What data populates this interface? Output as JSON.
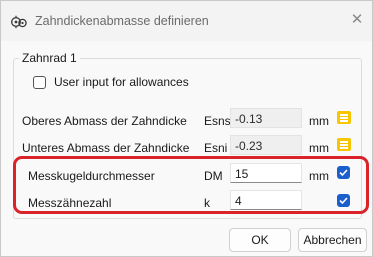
{
  "window": {
    "title": "Zahndickenabmasse definieren",
    "app_icon": "gear-icon",
    "close_glyph": "✕"
  },
  "group": {
    "label": "Zahnrad 1"
  },
  "allowance_checkbox": {
    "label": "User input for allowances",
    "checked": false
  },
  "rows": [
    {
      "label": "Oberes Abmass der Zahndicke",
      "symbol": "Esns",
      "value": "-0.13",
      "unit": "mm",
      "control": "menu-icon",
      "editable": false
    },
    {
      "label": "Unteres Abmass der Zahndicke",
      "symbol": "Esni",
      "value": "-0.23",
      "unit": "mm",
      "control": "menu-icon",
      "editable": false
    },
    {
      "label": "Messkugeldurchmesser",
      "symbol": "DM",
      "value": "15",
      "unit": "mm",
      "control": "checkbox",
      "checked": true,
      "editable": true
    },
    {
      "label": "Messzähnezahl",
      "symbol": "k",
      "value": "4",
      "unit": "",
      "control": "checkbox",
      "checked": true,
      "editable": true
    }
  ],
  "buttons": {
    "ok": "OK",
    "cancel": "Abbrechen"
  },
  "colors": {
    "highlight": "#d9222a",
    "checkbox_accent": "#1b5fcc",
    "menu_button": "#f7c600"
  }
}
